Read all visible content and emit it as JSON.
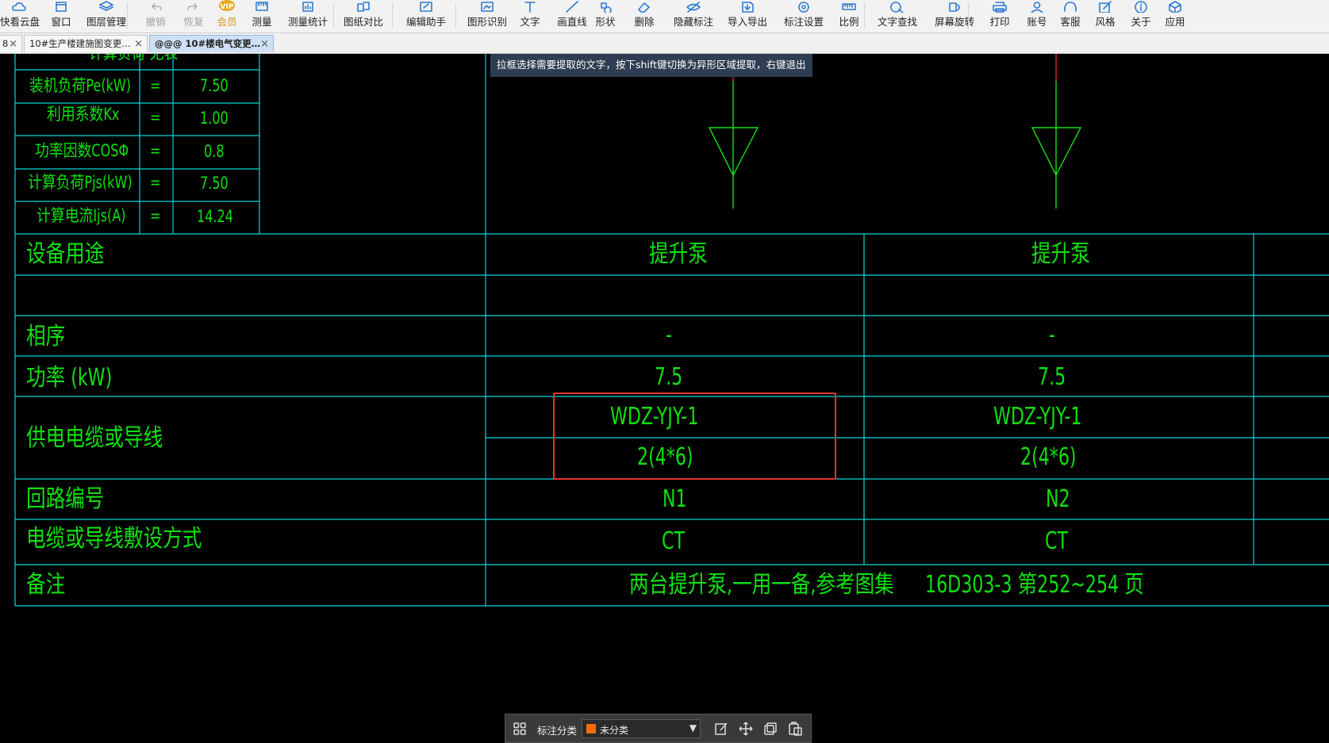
{
  "toolbar": {
    "items": [
      {
        "label": "快看云盘",
        "icon": "cloud-icon"
      },
      {
        "label": "窗口",
        "icon": "window-icon"
      },
      {
        "label": "图层管理",
        "icon": "layers-icon"
      },
      {
        "label": "撤销",
        "icon": "undo-icon"
      },
      {
        "label": "恢复",
        "icon": "redo-icon"
      },
      {
        "label": "会员",
        "icon": "vip-icon"
      },
      {
        "label": "测量",
        "icon": "measure-icon"
      },
      {
        "label": "测量统计",
        "icon": "measure-stats-icon"
      },
      {
        "label": "图纸对比",
        "icon": "compare-icon"
      },
      {
        "label": "编辑助手",
        "icon": "edit-assistant-icon"
      },
      {
        "label": "图形识别",
        "icon": "shape-recognition-icon"
      },
      {
        "label": "文字",
        "icon": "text-icon"
      },
      {
        "label": "画直线",
        "icon": "line-icon"
      },
      {
        "label": "形状",
        "icon": "shape-icon"
      },
      {
        "label": "删除",
        "icon": "eraser-icon"
      },
      {
        "label": "隐藏标注",
        "icon": "hide-eye-icon"
      },
      {
        "label": "导入导出",
        "icon": "import-export-icon"
      },
      {
        "label": "标注设置",
        "icon": "annotation-settings-icon"
      },
      {
        "label": "比例",
        "icon": "ruler-icon"
      },
      {
        "label": "文字查找",
        "icon": "text-search-icon"
      },
      {
        "label": "屏幕旋转",
        "icon": "rotate-screen-icon"
      },
      {
        "label": "打印",
        "icon": "printer-icon"
      },
      {
        "label": "账号",
        "icon": "user-icon"
      },
      {
        "label": "客服",
        "icon": "headset-icon"
      },
      {
        "label": "风格",
        "icon": "style-icon"
      },
      {
        "label": "关于",
        "icon": "info-icon"
      },
      {
        "label": "应用",
        "icon": "cube-icon"
      }
    ]
  },
  "tabs": [
    {
      "label": "8"
    },
    {
      "label": "10#生产楼建施图变更…"
    },
    {
      "label": "@@@  10#楼电气变更…"
    }
  ],
  "hint": "拉框选择需要提取的文字，按下shift键切换为异形区域提取，右键退出",
  "drawing": {
    "partial_header": "计算负荷 无表",
    "calc_table": [
      {
        "label": "装机负荷Pe(kW)",
        "eq": "=",
        "value": "7.50"
      },
      {
        "label": "利用系数Kx",
        "eq": "=",
        "value": "1.00"
      },
      {
        "label": "功率因数COSΦ",
        "eq": "=",
        "value": "0.8"
      },
      {
        "label": "计算负荷Pjs(kW)",
        "eq": "=",
        "value": "7.50"
      },
      {
        "label": "计算电流Ijs(A)",
        "eq": "=",
        "value": "14.24"
      }
    ],
    "rows": {
      "usage": {
        "label": "设备用途",
        "n1": "提升泵",
        "n2": "提升泵"
      },
      "phase": {
        "label": "相序",
        "n1": "-",
        "n2": "-"
      },
      "power": {
        "label": "功率 (kW)",
        "n1": "7.5",
        "n2": "7.5"
      },
      "cable": {
        "label": "供电电缆或导线",
        "n1_line1": "WDZ-YJY-1",
        "n1_line2": "2(4*6)",
        "n2_line1": "WDZ-YJY-1",
        "n2_line2": "2(4*6)"
      },
      "circuit": {
        "label": "回路编号",
        "n1": "N1",
        "n2": "N2"
      },
      "laying": {
        "label": "电缆或导线敷设方式",
        "n1": "CT",
        "n2": "CT"
      },
      "remark": {
        "label": "备注",
        "text_a": "两台提升泵,一用一备,参考图集",
        "text_b": "16D303-3   第252~254 页"
      }
    }
  },
  "bottombar": {
    "label": "标注分类",
    "select_value": "未分类",
    "swatch_color": "#ff6a00"
  }
}
